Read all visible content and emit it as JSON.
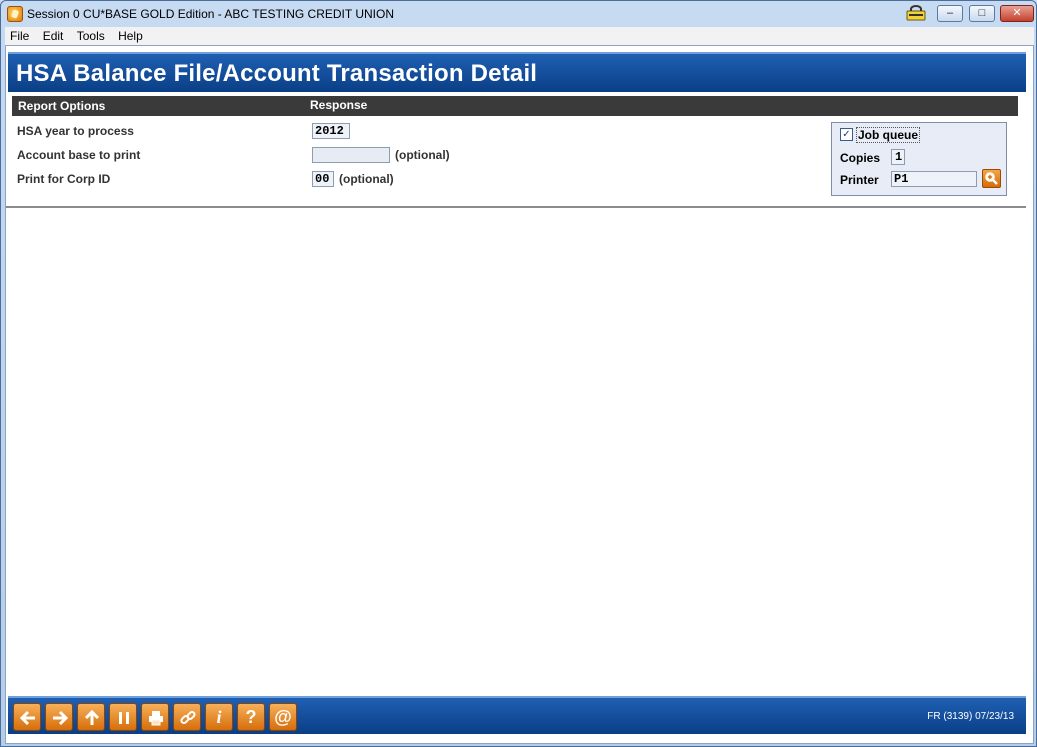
{
  "window": {
    "title": "Session 0 CU*BASE GOLD Edition - ABC TESTING CREDIT UNION",
    "minimize_label": "–",
    "maximize_label": "□",
    "close_label": "✕"
  },
  "menu": [
    "File",
    "Edit",
    "Tools",
    "Help"
  ],
  "page": {
    "title": "HSA Balance File/Account Transaction Detail"
  },
  "columns": {
    "options": "Report Options",
    "response": "Response"
  },
  "fields": {
    "hsa_year": {
      "label": "HSA year to process",
      "value": "2012"
    },
    "account_base": {
      "label": "Account base to print",
      "value": "",
      "suffix": "(optional)"
    },
    "corp_id": {
      "label": "Print for Corp ID",
      "value": "00",
      "suffix": "(optional)"
    }
  },
  "print_options": {
    "job_queue_label": "Job queue",
    "job_queue_checked": true,
    "copies_label": "Copies",
    "copies_value": "1",
    "printer_label": "Printer",
    "printer_value": "P1"
  },
  "footer": {
    "buttons": [
      "back-icon",
      "forward-icon",
      "up-icon",
      "pause-icon",
      "print-icon",
      "link-icon",
      "info-icon",
      "help-icon",
      "email-icon"
    ],
    "status": "FR (3139) 07/23/13"
  },
  "colors": {
    "header_blue": "#0a3f86",
    "button_orange": "#d66d0a"
  }
}
